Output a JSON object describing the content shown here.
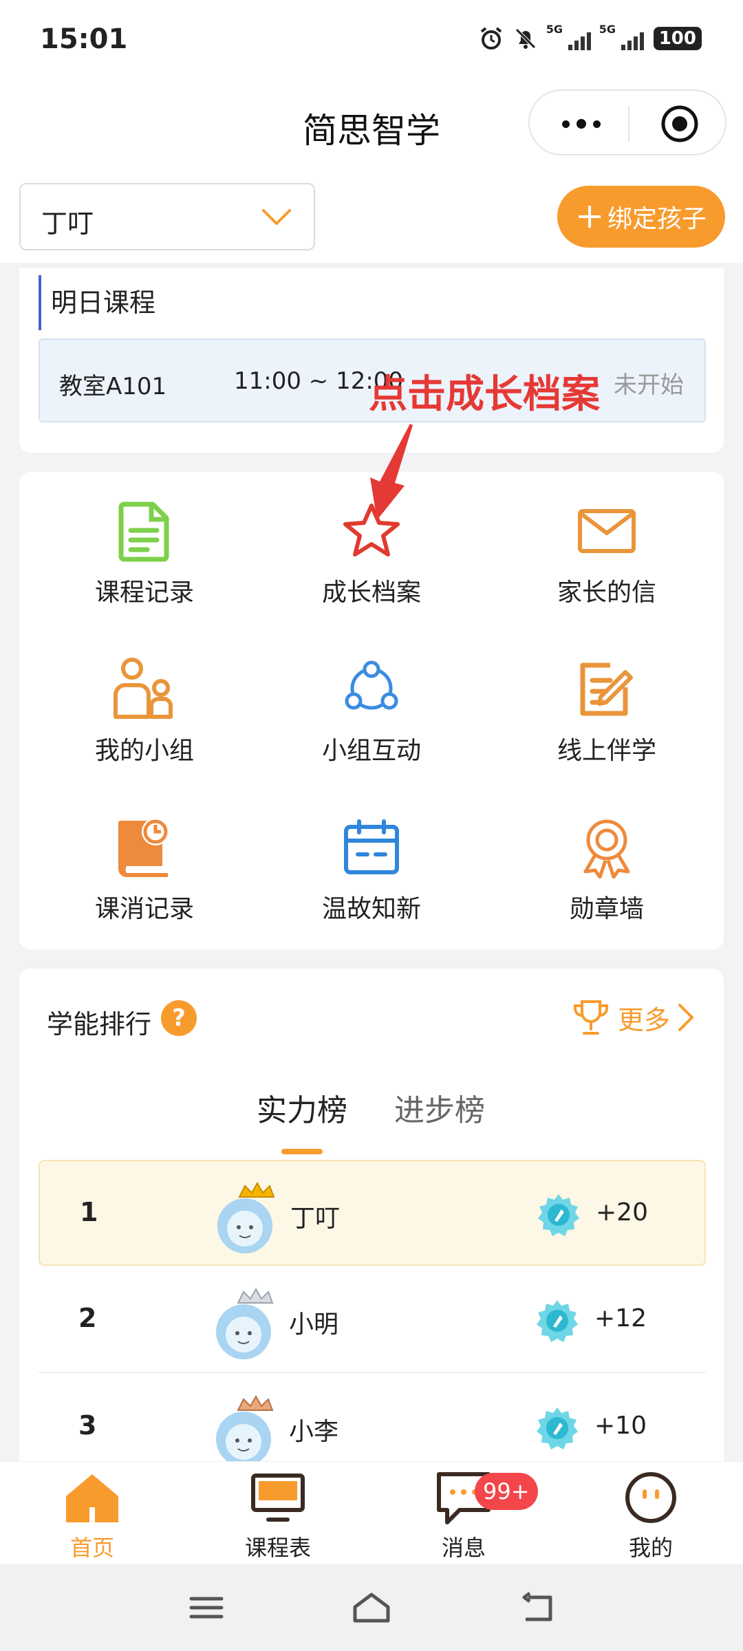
{
  "status_bar": {
    "time": "15:01",
    "network_1": "5G",
    "network_2": "5G",
    "battery": "100"
  },
  "nav": {
    "title": "简思智学"
  },
  "child_selector": {
    "value": "丁叮"
  },
  "bind_button": {
    "label": "绑定孩子"
  },
  "tomorrow": {
    "heading": "明日课程",
    "room": "教室A101",
    "time": "11:00 ~ 12:00",
    "status": "未开始"
  },
  "annotation": {
    "text": "点击成长档案"
  },
  "features": [
    {
      "label": "课程记录",
      "icon": "document-icon"
    },
    {
      "label": "成长档案",
      "icon": "star-icon"
    },
    {
      "label": "家长的信",
      "icon": "envelope-icon"
    },
    {
      "label": "我的小组",
      "icon": "group-icon"
    },
    {
      "label": "小组互动",
      "icon": "share-icon"
    },
    {
      "label": "线上伴学",
      "icon": "edit-icon"
    },
    {
      "label": "课消记录",
      "icon": "book-clock-icon"
    },
    {
      "label": "温故知新",
      "icon": "calendar-icon"
    },
    {
      "label": "勋章墙",
      "icon": "medal-icon"
    }
  ],
  "ranking": {
    "title": "学能排行",
    "help": "?",
    "more": "更多",
    "tabs": [
      {
        "label": "实力榜",
        "active": true
      },
      {
        "label": "进步榜",
        "active": false
      }
    ],
    "rows": [
      {
        "rank": "1",
        "name": "丁叮",
        "score": "+20",
        "crown": "gold"
      },
      {
        "rank": "2",
        "name": "小明",
        "score": "+12",
        "crown": "silver"
      },
      {
        "rank": "3",
        "name": "小李",
        "score": "+10",
        "crown": "bronze"
      }
    ]
  },
  "tabbar": {
    "items": [
      {
        "label": "首页",
        "icon": "home-icon",
        "active": true
      },
      {
        "label": "课程表",
        "icon": "monitor-icon",
        "active": false
      },
      {
        "label": "消息",
        "icon": "chat-icon",
        "active": false
      },
      {
        "label": "我的",
        "icon": "profile-icon",
        "active": false
      }
    ],
    "message_badge": "99+"
  },
  "colors": {
    "accent": "#f89b2d",
    "annotation": "#e53935",
    "course_bg": "#edf3fb",
    "rank_highlight": "#fdf7e6"
  }
}
